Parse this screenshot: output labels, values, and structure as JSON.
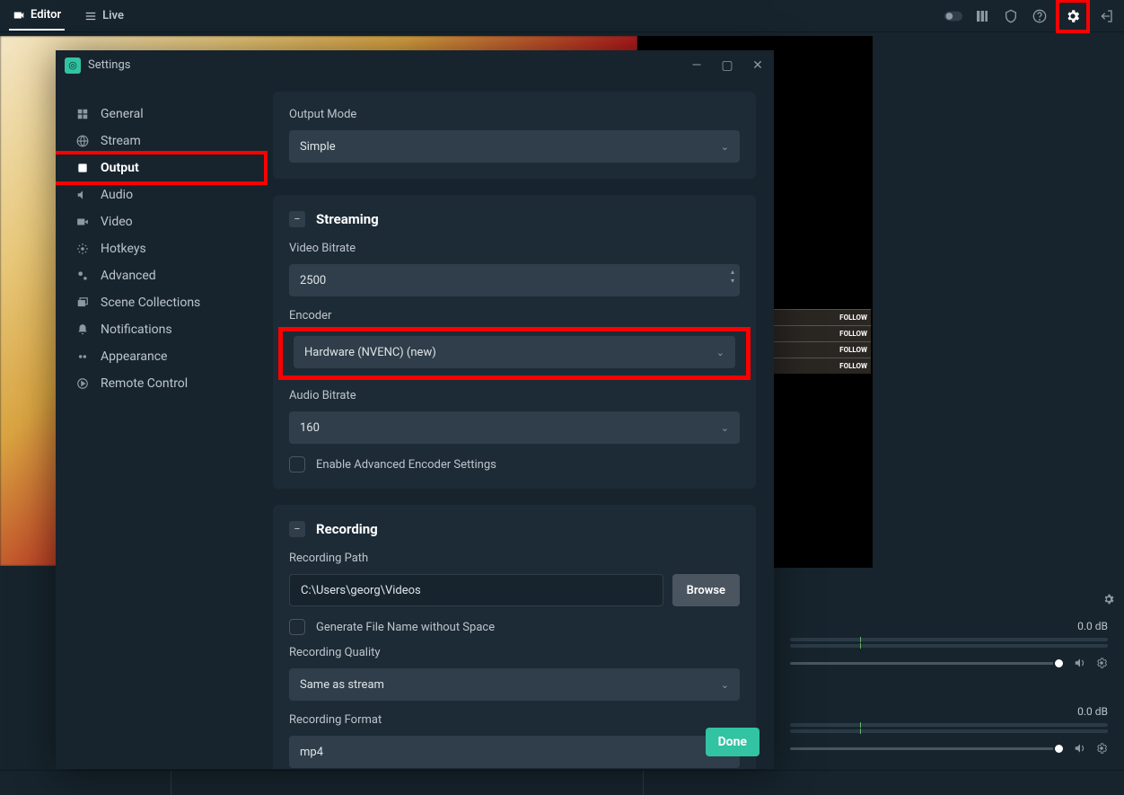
{
  "topbar": {
    "tabs": {
      "editor": "Editor",
      "live": "Live"
    }
  },
  "modal": {
    "title": "Settings",
    "nav": {
      "general": "General",
      "stream": "Stream",
      "output": "Output",
      "audio": "Audio",
      "video": "Video",
      "hotkeys": "Hotkeys",
      "advanced": "Advanced",
      "scene_collections": "Scene Collections",
      "notifications": "Notifications",
      "appearance": "Appearance",
      "remote_control": "Remote Control"
    },
    "output_mode": {
      "label": "Output Mode",
      "value": "Simple"
    },
    "streaming": {
      "title": "Streaming",
      "video_bitrate_label": "Video Bitrate",
      "video_bitrate_value": "2500",
      "encoder_label": "Encoder",
      "encoder_value": "Hardware (NVENC) (new)",
      "audio_bitrate_label": "Audio Bitrate",
      "audio_bitrate_value": "160",
      "advanced_checkbox": "Enable Advanced Encoder Settings"
    },
    "recording": {
      "title": "Recording",
      "path_label": "Recording Path",
      "path_value": "C:\\Users\\georg\\Videos",
      "browse": "Browse",
      "gen_filename": "Generate File Name without Space",
      "quality_label": "Recording Quality",
      "quality_value": "Same as stream",
      "format_label": "Recording Format",
      "format_value": "mp4"
    },
    "done": "Done"
  },
  "follow_text": "FOLLOW",
  "mixer": {
    "db1": "0.0 dB",
    "db2": "0.0 dB"
  }
}
